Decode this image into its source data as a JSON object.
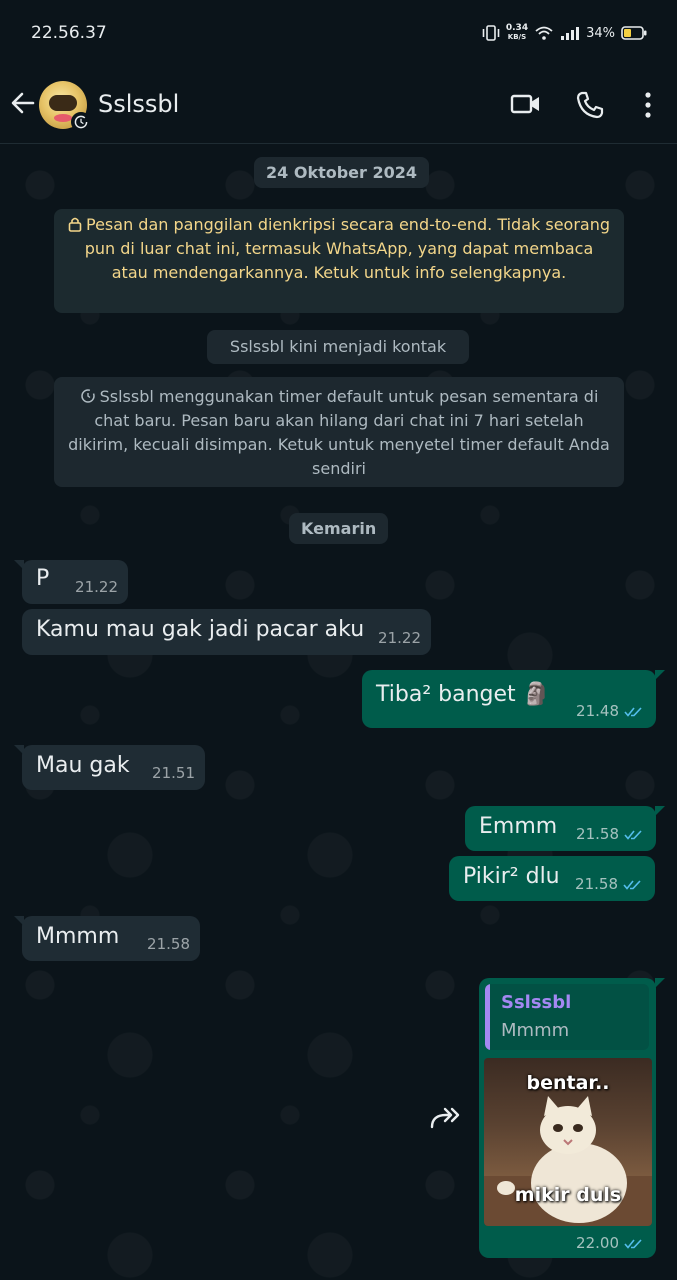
{
  "status_bar": {
    "time": "22.56.37",
    "net_speed": "0.34",
    "net_unit": "KB/S",
    "battery": "34%"
  },
  "header": {
    "contact_name": "Sslssbl"
  },
  "chat": {
    "date_1": "24 Oktober 2024",
    "encryption_notice": "Pesan dan panggilan dienkripsi secara end-to-end. Tidak seorang pun di luar chat ini, termasuk WhatsApp, yang dapat membaca atau mendengarkannya. Ketuk untuk info selengkapnya.",
    "contact_added": "Sslssbl kini menjadi kontak",
    "timer_notice": "Sslssbl menggunakan timer default untuk pesan sementara di chat baru. Pesan baru akan hilang dari chat ini 7 hari setelah dikirim, kecuali disimpan. Ketuk untuk menyetel timer default Anda sendiri",
    "date_2": "Kemarin",
    "messages": [
      {
        "dir": "in",
        "text": "P",
        "time": "21.22"
      },
      {
        "dir": "in",
        "text": "Kamu mau gak jadi pacar aku",
        "time": "21.22"
      },
      {
        "dir": "out",
        "text": "Tiba² banget 🗿",
        "time": "21.48"
      },
      {
        "dir": "in",
        "text": "Mau gak",
        "time": "21.51"
      },
      {
        "dir": "out",
        "text": "Emmm",
        "time": "21.58"
      },
      {
        "dir": "out",
        "text": "Pikir² dlu",
        "time": "21.58"
      },
      {
        "dir": "in",
        "text": "Mmmm",
        "time": "21.58"
      }
    ],
    "reply": {
      "quoted_name": "Sslssbl",
      "quoted_text": "Mmmm",
      "sticker_top": "bentar..",
      "sticker_bottom": "mikir duls",
      "time": "22.00"
    }
  },
  "colors": {
    "background": "#0b141a",
    "incoming": "#1f2c34",
    "outgoing": "#005c4b",
    "read_ticks": "#53bdeb",
    "quote_name": "#a488f2"
  }
}
